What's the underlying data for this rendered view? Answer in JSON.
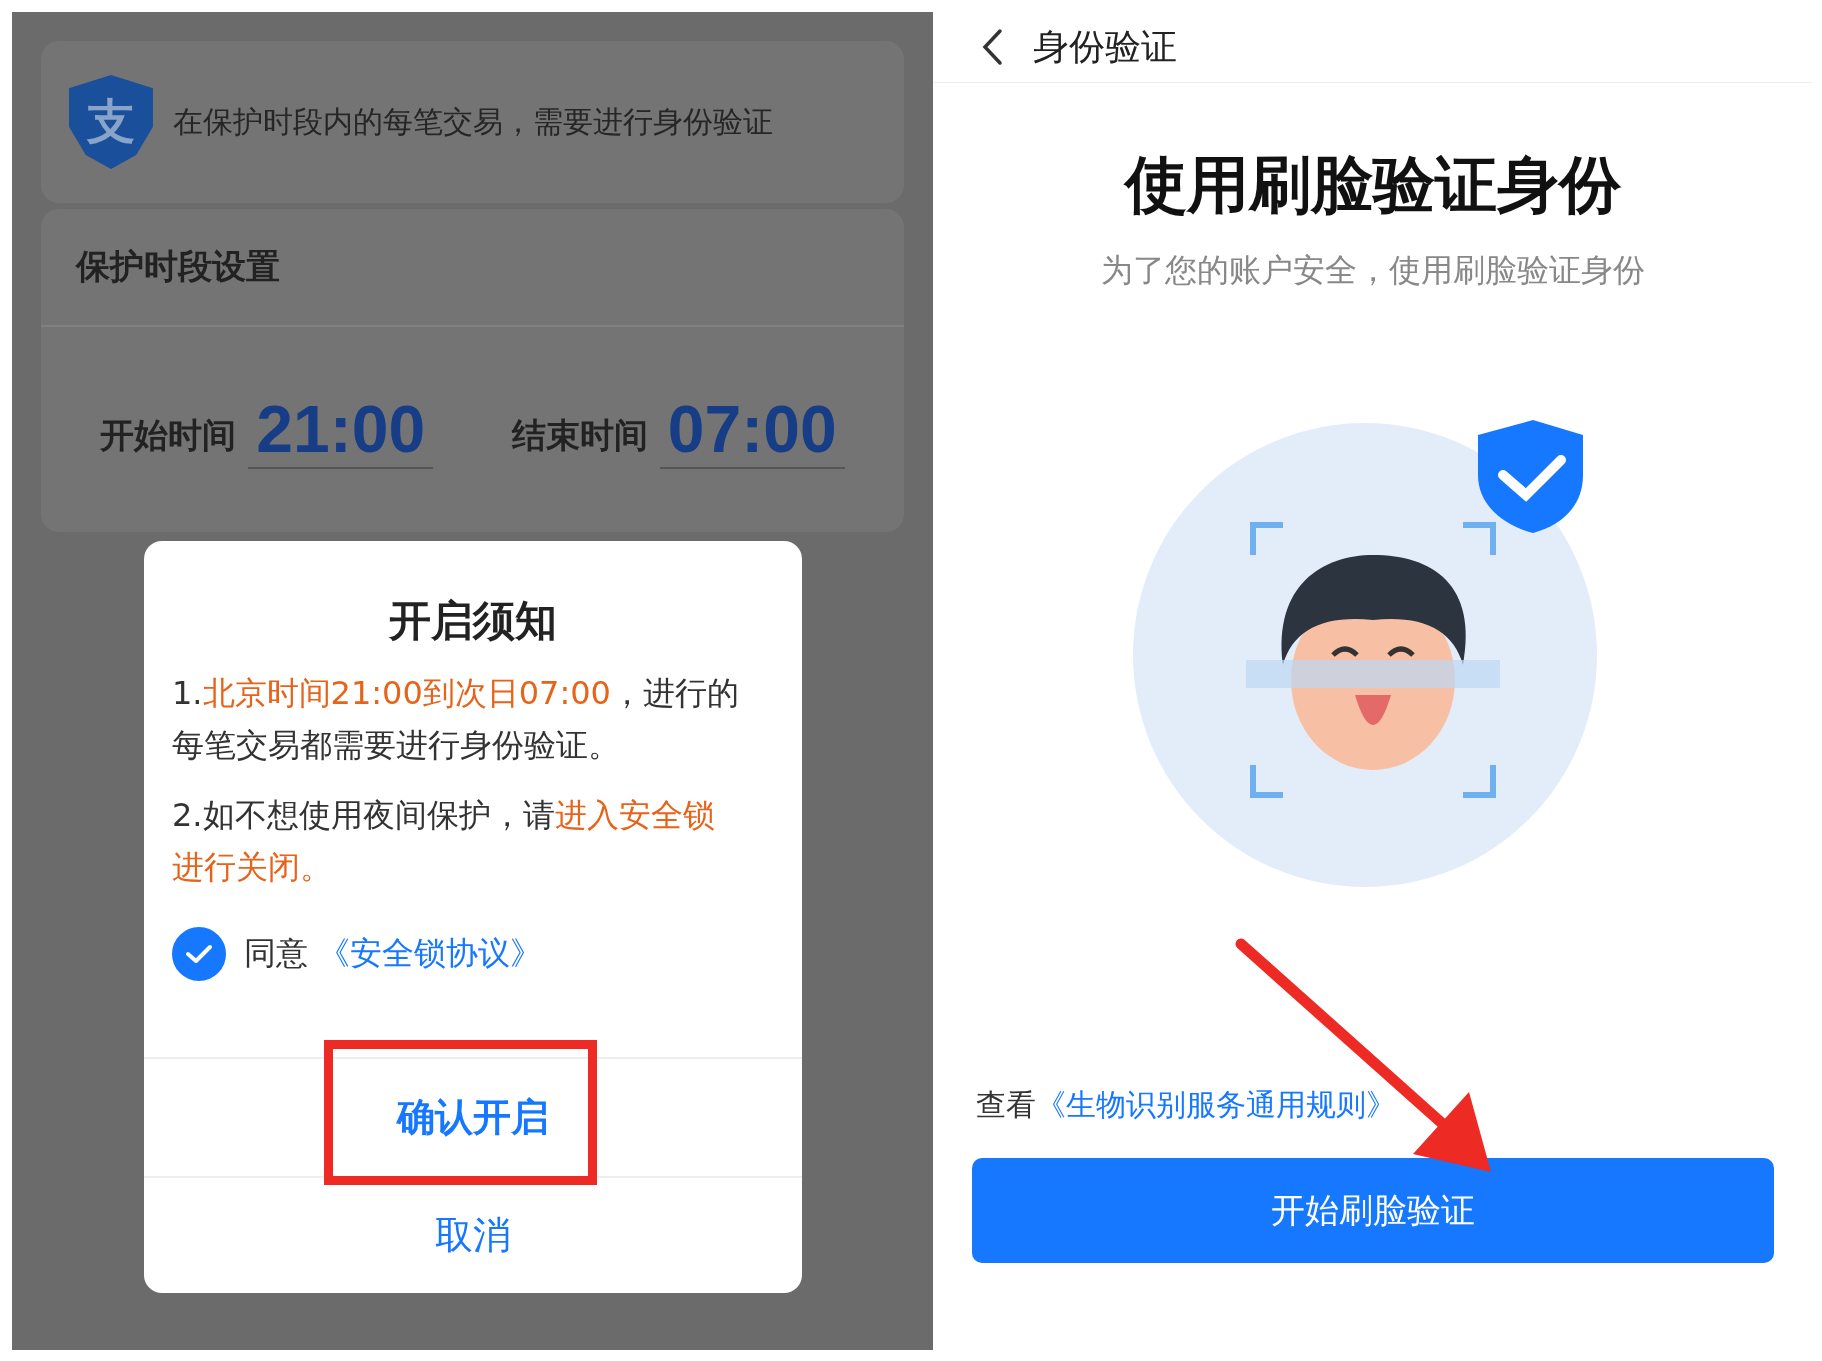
{
  "left_screen": {
    "banner": {
      "logo_char": "支",
      "text": "在保护时段内的每笔交易，需要进行身份验证"
    },
    "protection": {
      "title": "保护时段设置",
      "start_label": "开始时间",
      "start_time": "21:00",
      "end_label": "结束时间",
      "end_time": "07:00"
    },
    "dialog": {
      "title": "开启须知",
      "notes": [
        [
          {
            "text": "1.",
            "highlight": false
          },
          {
            "text": "北京时间21:00到次日07:00",
            "highlight": true
          },
          {
            "text": "，进行的每笔交易都需要进行身份验证。",
            "highlight": false
          }
        ],
        [
          {
            "text": "2.如不想使用夜间保护，请",
            "highlight": false
          },
          {
            "text": "进入安全锁进行关闭。",
            "highlight": true
          }
        ]
      ],
      "agree": {
        "checked": true,
        "label": "同意",
        "link": "《安全锁协议》"
      },
      "confirm_button": "确认开启",
      "cancel_button": "取消"
    }
  },
  "right_screen": {
    "nav": {
      "title": "身份验证"
    },
    "heading": "使用刷脸验证身份",
    "subtitle": "为了您的账户安全，使用刷脸验证身份",
    "terms": {
      "prefix": "查看",
      "link": "《生物识别服务通用规则》"
    },
    "start_button": "开始刷脸验证"
  }
}
